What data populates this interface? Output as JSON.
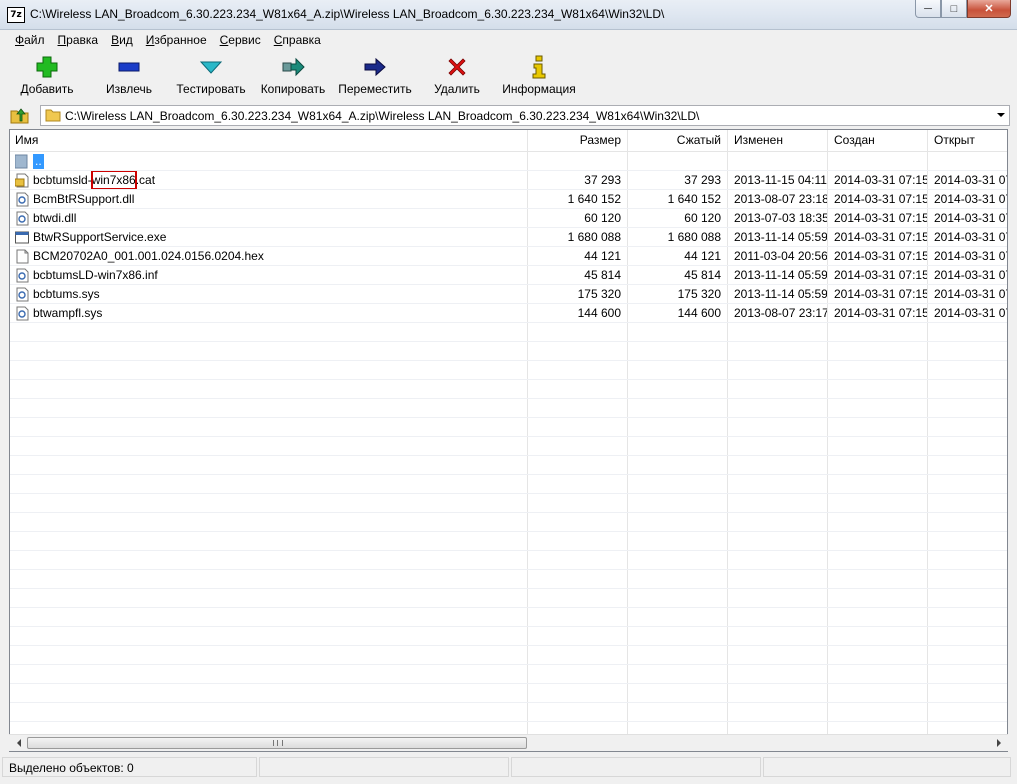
{
  "window": {
    "title": "C:\\Wireless LAN_Broadcom_6.30.223.234_W81x64_A.zip\\Wireless LAN_Broadcom_6.30.223.234_W81x64\\Win32\\LD\\",
    "app_icon_text": "7z",
    "minimize_glyph": "─",
    "maximize_glyph": "□",
    "close_glyph": "✕"
  },
  "menu": [
    {
      "key": "Ф",
      "rest": "айл"
    },
    {
      "key": "П",
      "rest": "равка"
    },
    {
      "key": "В",
      "rest": "ид"
    },
    {
      "key": "И",
      "rest": "збранное"
    },
    {
      "key": "С",
      "rest": "ервис"
    },
    {
      "key": "С",
      "rest": "правка"
    }
  ],
  "toolbar": [
    {
      "label": "Добавить",
      "icon": "plus-icon",
      "color": "#22bb22"
    },
    {
      "label": "Извлечь",
      "icon": "minus-icon",
      "color": "#1a3cc8"
    },
    {
      "label": "Тестировать",
      "icon": "check-icon",
      "color": "#2ab8c8"
    },
    {
      "label": "Копировать",
      "icon": "copy-arrow-icon",
      "color": "#1a8a7a"
    },
    {
      "label": "Переместить",
      "icon": "move-arrow-icon",
      "color": "#1a2a8a"
    },
    {
      "label": "Удалить",
      "icon": "delete-x-icon",
      "color": "#dd1111"
    },
    {
      "label": "Информация",
      "icon": "info-icon",
      "color": "#e8c800"
    }
  ],
  "address": {
    "path": "C:\\Wireless LAN_Broadcom_6.30.223.234_W81x64_A.zip\\Wireless LAN_Broadcom_6.30.223.234_W81x64\\Win32\\LD\\"
  },
  "columns": {
    "name": "Имя",
    "size": "Размер",
    "packed": "Сжатый",
    "modified": "Изменен",
    "created": "Создан",
    "accessed": "Открыт"
  },
  "updir": {
    "name": ".."
  },
  "files": [
    {
      "name_pre": "bcbtumsld-",
      "name_hl": "win7x86",
      "name_post": ".cat",
      "size": "37 293",
      "packed": "37 293",
      "modified": "2013-11-15 04:11",
      "created": "2014-03-31 07:15",
      "accessed": "2014-03-31 07",
      "icon": "catalog-file-icon"
    },
    {
      "name_pre": "BcmBtRSupport.dll",
      "name_hl": "",
      "name_post": "",
      "size": "1 640 152",
      "packed": "1 640 152",
      "modified": "2013-08-07 23:18",
      "created": "2014-03-31 07:15",
      "accessed": "2014-03-31 07",
      "icon": "dll-file-icon"
    },
    {
      "name_pre": "btwdi.dll",
      "name_hl": "",
      "name_post": "",
      "size": "60 120",
      "packed": "60 120",
      "modified": "2013-07-03 18:35",
      "created": "2014-03-31 07:15",
      "accessed": "2014-03-31 07",
      "icon": "dll-file-icon"
    },
    {
      "name_pre": "BtwRSupportService.exe",
      "name_hl": "",
      "name_post": "",
      "size": "1 680 088",
      "packed": "1 680 088",
      "modified": "2013-11-14 05:59",
      "created": "2014-03-31 07:15",
      "accessed": "2014-03-31 07",
      "icon": "exe-file-icon"
    },
    {
      "name_pre": "BCM20702A0_001.001.024.0156.0204.hex",
      "name_hl": "",
      "name_post": "",
      "size": "44 121",
      "packed": "44 121",
      "modified": "2011-03-04 20:56",
      "created": "2014-03-31 07:15",
      "accessed": "2014-03-31 07",
      "icon": "blank-file-icon"
    },
    {
      "name_pre": "bcbtumsLD-win7x86.inf",
      "name_hl": "",
      "name_post": "",
      "size": "45 814",
      "packed": "45 814",
      "modified": "2013-11-14 05:59",
      "created": "2014-03-31 07:15",
      "accessed": "2014-03-31 07",
      "icon": "inf-file-icon"
    },
    {
      "name_pre": "bcbtums.sys",
      "name_hl": "",
      "name_post": "",
      "size": "175 320",
      "packed": "175 320",
      "modified": "2013-11-14 05:59",
      "created": "2014-03-31 07:15",
      "accessed": "2014-03-31 07",
      "icon": "sys-file-icon"
    },
    {
      "name_pre": "btwampfl.sys",
      "name_hl": "",
      "name_post": "",
      "size": "144 600",
      "packed": "144 600",
      "modified": "2013-08-07 23:17",
      "created": "2014-03-31 07:15",
      "accessed": "2014-03-31 07",
      "icon": "sys-file-icon"
    }
  ],
  "status": {
    "selected": "Выделено объектов: 0",
    "panel2": "",
    "panel3": "",
    "panel4": ""
  },
  "colors": {
    "selection": "#3399ff",
    "highlight_box": "#cc0000"
  }
}
